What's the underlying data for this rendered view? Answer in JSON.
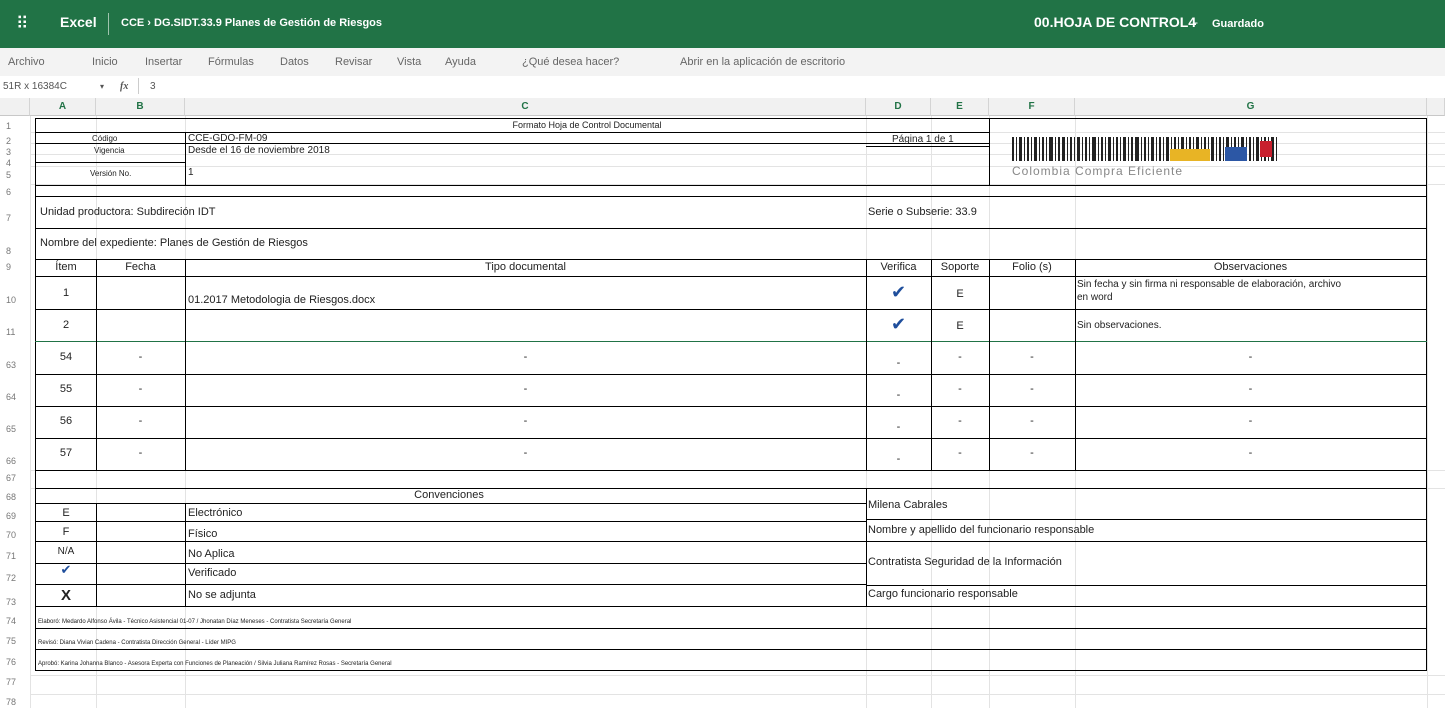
{
  "titlebar": {
    "app_name": "Excel",
    "breadcrumb": "CCE › DG.SIDT.33.9 Planes de Gestión de Riesgos",
    "doc_title": "00.HOJA DE CONTROL4",
    "dot": "-",
    "status": "Guardado"
  },
  "menu": {
    "archivo": "Archivo",
    "inicio": "Inicio",
    "insertar": "Insertar",
    "formulas": "Fórmulas",
    "datos": "Datos",
    "revisar": "Revisar",
    "vista": "Vista",
    "ayuda": "Ayuda",
    "que_desea": "¿Qué desea hacer?",
    "abrir": "Abrir en la aplicación de escritorio"
  },
  "formula_bar": {
    "name_box": "51R x 16384C",
    "fx": "fx",
    "value": "3"
  },
  "columns": [
    "A",
    "B",
    "C",
    "D",
    "E",
    "F",
    "G"
  ],
  "rows": [
    "1",
    "2",
    "3",
    "4",
    "5",
    "6",
    "7",
    "8",
    "9",
    "10",
    "11",
    "63",
    "64",
    "65",
    "66",
    "67",
    "68",
    "69",
    "70",
    "71",
    "72",
    "73",
    "74",
    "75",
    "76",
    "77",
    "78"
  ],
  "header": {
    "form_title": "Formato Hoja de Control Documental",
    "codigo_label": "Código",
    "codigo_value": "CCE-GDO-FM-09",
    "vigencia_label": "Vigencia",
    "vigencia_value": "Desde el 16 de noviembre 2018",
    "version_label": "Versión No.",
    "version_value": "1",
    "pagina": "Página 1 de 1",
    "logo_text": "Colombia Compra Eficiente"
  },
  "info": {
    "unidad": "Unidad productora: Subdireción IDT",
    "serie": "Serie o Subserie:  33.9",
    "expediente": "Nombre del expediente: Planes de Gestión de Riesgos"
  },
  "table": {
    "headers": {
      "item": "Ítem",
      "fecha": "Fecha",
      "tipo": "Tipo documental",
      "verifica": "Verifica",
      "soporte": "Soporte",
      "folio": "Folio (s)",
      "observaciones": "Observaciones"
    },
    "rows": [
      {
        "item": "1",
        "fecha": "",
        "tipo": "01.2017 Metodologia de Riesgos.docx",
        "verifica": "✔",
        "soporte": "E",
        "folio": "",
        "obs1": "Sin fecha y sin firma ni responsable de elaboración, archivo",
        "obs2": "en word"
      },
      {
        "item": "2",
        "fecha": "",
        "tipo": "",
        "verifica": "✔",
        "soporte": "E",
        "folio": "",
        "obs1": "Sin observaciones.",
        "obs2": ""
      },
      {
        "item": "54",
        "fecha": "-",
        "tipo": "-",
        "verifica": "-",
        "soporte": "-",
        "folio": "-",
        "obs1": "-",
        "obs2": ""
      },
      {
        "item": "55",
        "fecha": "-",
        "tipo": "-",
        "verifica": "-",
        "soporte": "-",
        "folio": "-",
        "obs1": "-",
        "obs2": ""
      },
      {
        "item": "56",
        "fecha": "-",
        "tipo": "-",
        "verifica": "-",
        "soporte": "-",
        "folio": "-",
        "obs1": "-",
        "obs2": ""
      },
      {
        "item": "57",
        "fecha": "-",
        "tipo": "-",
        "verifica": "-",
        "soporte": "-",
        "folio": "-",
        "obs1": "-",
        "obs2": ""
      }
    ]
  },
  "convenciones": {
    "title": "Convenciones",
    "items": [
      {
        "code": "E",
        "label": "Electrónico"
      },
      {
        "code": "F",
        "label": "Físico"
      },
      {
        "code": "N/A",
        "label": "No Aplica"
      },
      {
        "code": "✔",
        "label": "Verificado"
      },
      {
        "code": "X",
        "label": "No se adjunta"
      }
    ]
  },
  "responsable": {
    "nombre": "Milena Cabrales",
    "nombre_label": "Nombre y apellido del funcionario responsable",
    "cargo": "Contratista Seguridad de la Información",
    "cargo_label": "Cargo funcionario responsable"
  },
  "firmas": {
    "elaboro": "Elaboró: Medardo Alfonso Ávila - Técnico Asistencial 01-07 / Jhonatan Díaz Meneses - Contratista Secretaría General",
    "reviso": "Revisó: Diana Vivian Cadena - Contratista Dirección General - Líder MIPG",
    "aprobo": "Aprobó: Karina Johanna Blanco - Asesora Experta con Funciones de Planeación / Silvia Juliana Ramírez Rosas - Secretaría General"
  },
  "colors": {
    "excel_green": "#217346",
    "check_blue": "#1f4e9c"
  }
}
